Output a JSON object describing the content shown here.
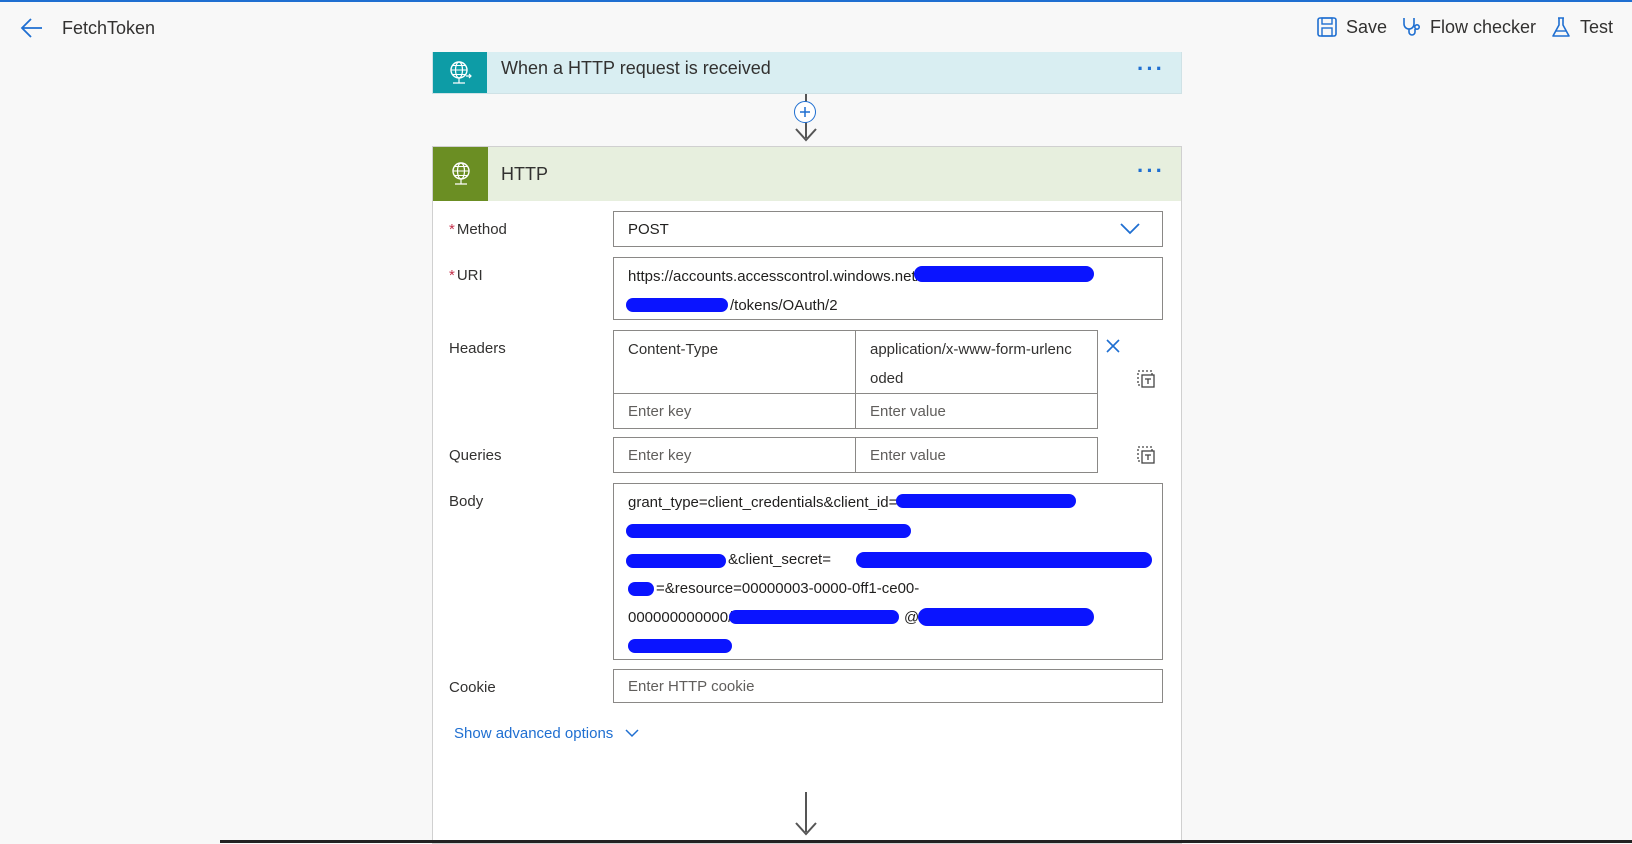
{
  "header": {
    "title": "FetchToken",
    "save_label": "Save",
    "checker_label": "Flow checker",
    "test_label": "Test"
  },
  "trigger": {
    "title": "When a HTTP request is received",
    "menu": "···"
  },
  "http_action": {
    "title": "HTTP",
    "menu": "···",
    "method": {
      "label": "Method",
      "required": "*",
      "value": "POST"
    },
    "uri": {
      "label": "URI",
      "required": "*",
      "line1": "https://accounts.accesscontrol.windows.net/",
      "line2": "/tokens/OAuth/2"
    },
    "headers": {
      "label": "Headers",
      "key": "Content-Type",
      "value_line1": "application/x-www-form-urlenc",
      "value_line2": "oded",
      "key_placeholder": "Enter key",
      "value_placeholder": "Enter value"
    },
    "queries": {
      "label": "Queries",
      "key_placeholder": "Enter key",
      "value_placeholder": "Enter value"
    },
    "body": {
      "label": "Body",
      "line1": "grant_type=client_credentials&client_id=",
      "line3": "&client_secret=",
      "line4": "=&resource=00000003-0000-0ff1-ce00-",
      "line5a": "000000000000/",
      "line5b": "@"
    },
    "cookie": {
      "label": "Cookie",
      "placeholder": "Enter HTTP cookie"
    },
    "advanced_label": "Show advanced options"
  },
  "colors": {
    "accent": "#1f6fd1",
    "trigger_icon_bg": "#0d9ca6",
    "http_icon_bg": "#6b8e23",
    "redaction": "#0a14ff"
  },
  "icons": [
    "back-arrow-icon",
    "save-icon",
    "stethoscope-icon",
    "flask-icon",
    "globe-request-icon",
    "globe-http-icon",
    "plus-icon",
    "chevron-down-icon",
    "close-icon",
    "switch-text-mode-icon"
  ]
}
